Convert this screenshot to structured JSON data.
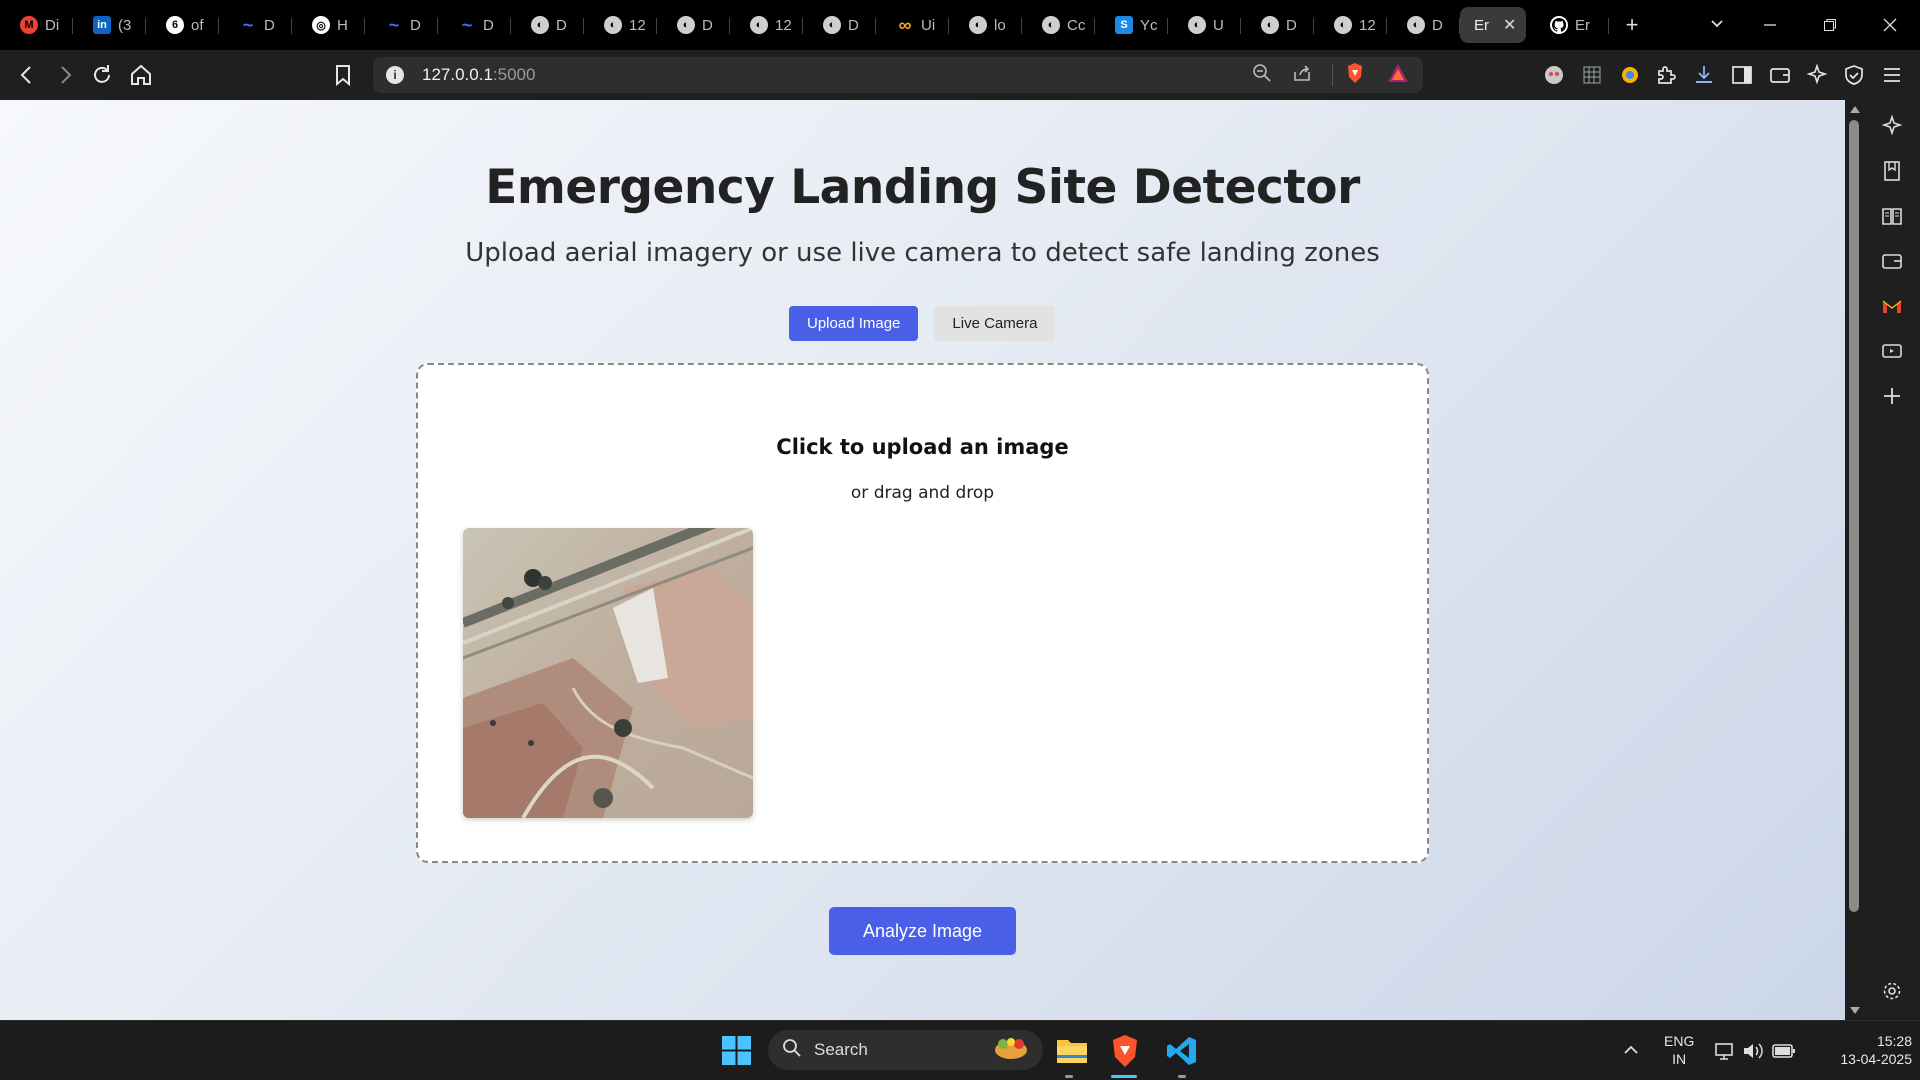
{
  "browser": {
    "tabs": [
      {
        "label": "Di",
        "icon": "gmail-icon",
        "color": "#ea4335"
      },
      {
        "label": "(3",
        "icon": "linkedin-icon",
        "color": "#0a66c2"
      },
      {
        "label": "of",
        "icon": "copilot-icon",
        "color": "#ffffff"
      },
      {
        "label": "D",
        "icon": "deepseek-icon",
        "color": "#4d6bfe"
      },
      {
        "label": "H",
        "icon": "openai-icon",
        "color": "#ffffff"
      },
      {
        "label": "D",
        "icon": "deepseek-icon",
        "color": "#4d6bfe"
      },
      {
        "label": "D",
        "icon": "deepseek-icon",
        "color": "#4d6bfe"
      },
      {
        "label": "D",
        "icon": "globe-icon",
        "color": "#cfcfcf"
      },
      {
        "label": "12",
        "icon": "globe-icon",
        "color": "#cfcfcf"
      },
      {
        "label": "D",
        "icon": "globe-icon",
        "color": "#cfcfcf"
      },
      {
        "label": "12",
        "icon": "globe-icon",
        "color": "#cfcfcf"
      },
      {
        "label": "D",
        "icon": "globe-icon",
        "color": "#cfcfcf"
      },
      {
        "label": "Ui",
        "icon": "infinity-icon",
        "color": "#f5a623"
      },
      {
        "label": "lo",
        "icon": "globe-icon",
        "color": "#cfcfcf"
      },
      {
        "label": "Cc",
        "icon": "globe-icon",
        "color": "#cfcfcf"
      },
      {
        "label": "Yc",
        "icon": "s-logo-icon",
        "color": "#1e88e5"
      },
      {
        "label": "U",
        "icon": "globe-icon",
        "color": "#cfcfcf"
      },
      {
        "label": "D",
        "icon": "globe-icon",
        "color": "#cfcfcf"
      },
      {
        "label": "12",
        "icon": "globe-icon",
        "color": "#cfcfcf"
      },
      {
        "label": "D",
        "icon": "globe-icon",
        "color": "#cfcfcf"
      }
    ],
    "active_tab": {
      "label": "Er"
    },
    "after_tab": {
      "label": "Er",
      "icon": "github-icon"
    },
    "url_host": "127.0.0.1",
    "url_port": ":5000"
  },
  "page": {
    "title": "Emergency Landing Site Detector",
    "subtitle": "Upload aerial imagery or use live camera to detect safe landing zones",
    "mode_upload": "Upload Image",
    "mode_camera": "Live Camera",
    "upload_heading": "Click to upload an image",
    "upload_sub": "or drag and drop",
    "analyze_label": "Analyze Image",
    "accent_color": "#4a5fe8"
  },
  "taskbar": {
    "search_label": "Search",
    "lang_line1": "ENG",
    "lang_line2": "IN",
    "time": "15:28",
    "date": "13-04-2025"
  }
}
